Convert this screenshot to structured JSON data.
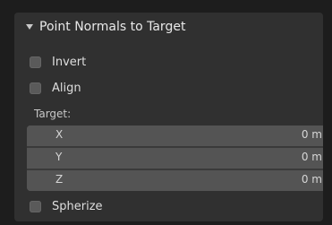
{
  "panel": {
    "title": "Point Normals to Target",
    "expanded": true
  },
  "options": [
    {
      "label": "Invert",
      "checked": false
    },
    {
      "label": "Align",
      "checked": false
    }
  ],
  "target": {
    "label": "Target:",
    "fields": [
      {
        "axis": "X",
        "value": "0 m"
      },
      {
        "axis": "Y",
        "value": "0 m"
      },
      {
        "axis": "Z",
        "value": "0 m"
      }
    ]
  },
  "spherize": {
    "label": "Spherize",
    "checked": false
  },
  "colors": {
    "background": "#1d1d1d",
    "panel": "#303030",
    "field": "#545454",
    "checkbox": "#5a5a5a",
    "text": "#dedede"
  }
}
